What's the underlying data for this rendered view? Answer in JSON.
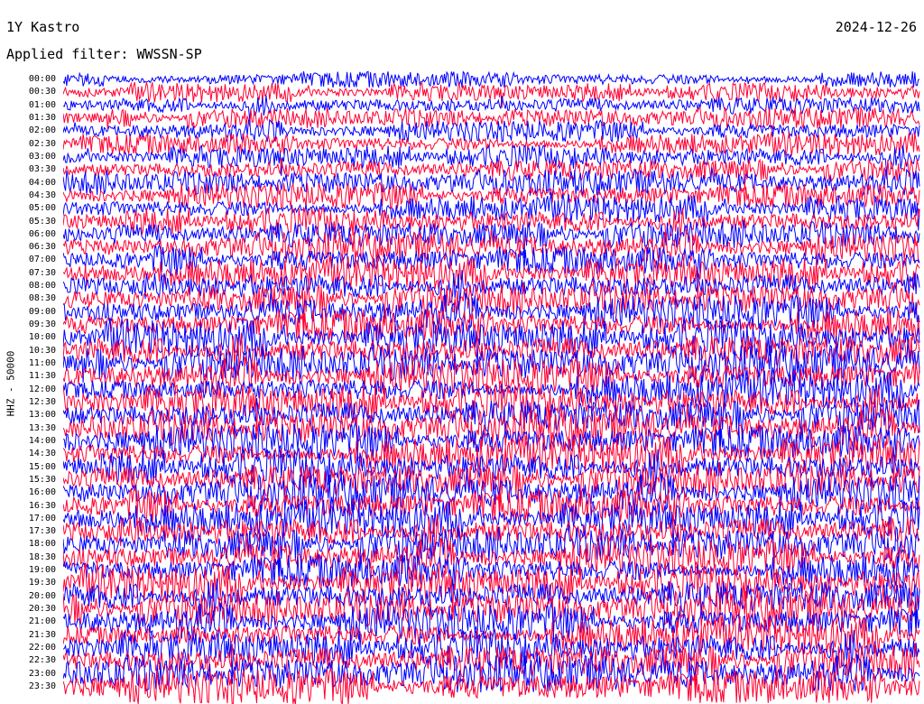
{
  "header": {
    "station": "1Y Kastro",
    "date": "2024-12-26",
    "filter": "Applied filter: WWSSN-SP"
  },
  "colors": {
    "trace_a": "#0000ff",
    "trace_b": "#ff0033",
    "background": "#ffffff",
    "text": "#000000"
  },
  "chart_data": {
    "type": "line",
    "title": "1Y Kastro",
    "subtitle": "Applied filter: WWSSN-SP",
    "ylabel": "HHZ - 50000",
    "xlabel": "",
    "grid": false,
    "legend": "none",
    "row_labels": [
      "00:00",
      "00:30",
      "01:00",
      "01:30",
      "02:00",
      "02:30",
      "03:00",
      "03:30",
      "04:00",
      "04:30",
      "05:00",
      "05:30",
      "06:00",
      "06:30",
      "07:00",
      "07:30",
      "08:00",
      "08:30",
      "09:00",
      "09:30",
      "10:00",
      "10:30",
      "11:00",
      "11:30",
      "12:00",
      "12:30",
      "13:00",
      "13:30",
      "14:00",
      "14:30",
      "15:00",
      "15:30",
      "16:00",
      "16:30",
      "17:00",
      "17:30",
      "18:00",
      "18:30",
      "19:00",
      "19:30",
      "20:00",
      "20:30",
      "21:00",
      "21:30",
      "22:00",
      "22:30",
      "23:00",
      "23:30"
    ],
    "row_colors": [
      "#0000ff",
      "#ff0033"
    ],
    "minutes_per_row": 30
  }
}
